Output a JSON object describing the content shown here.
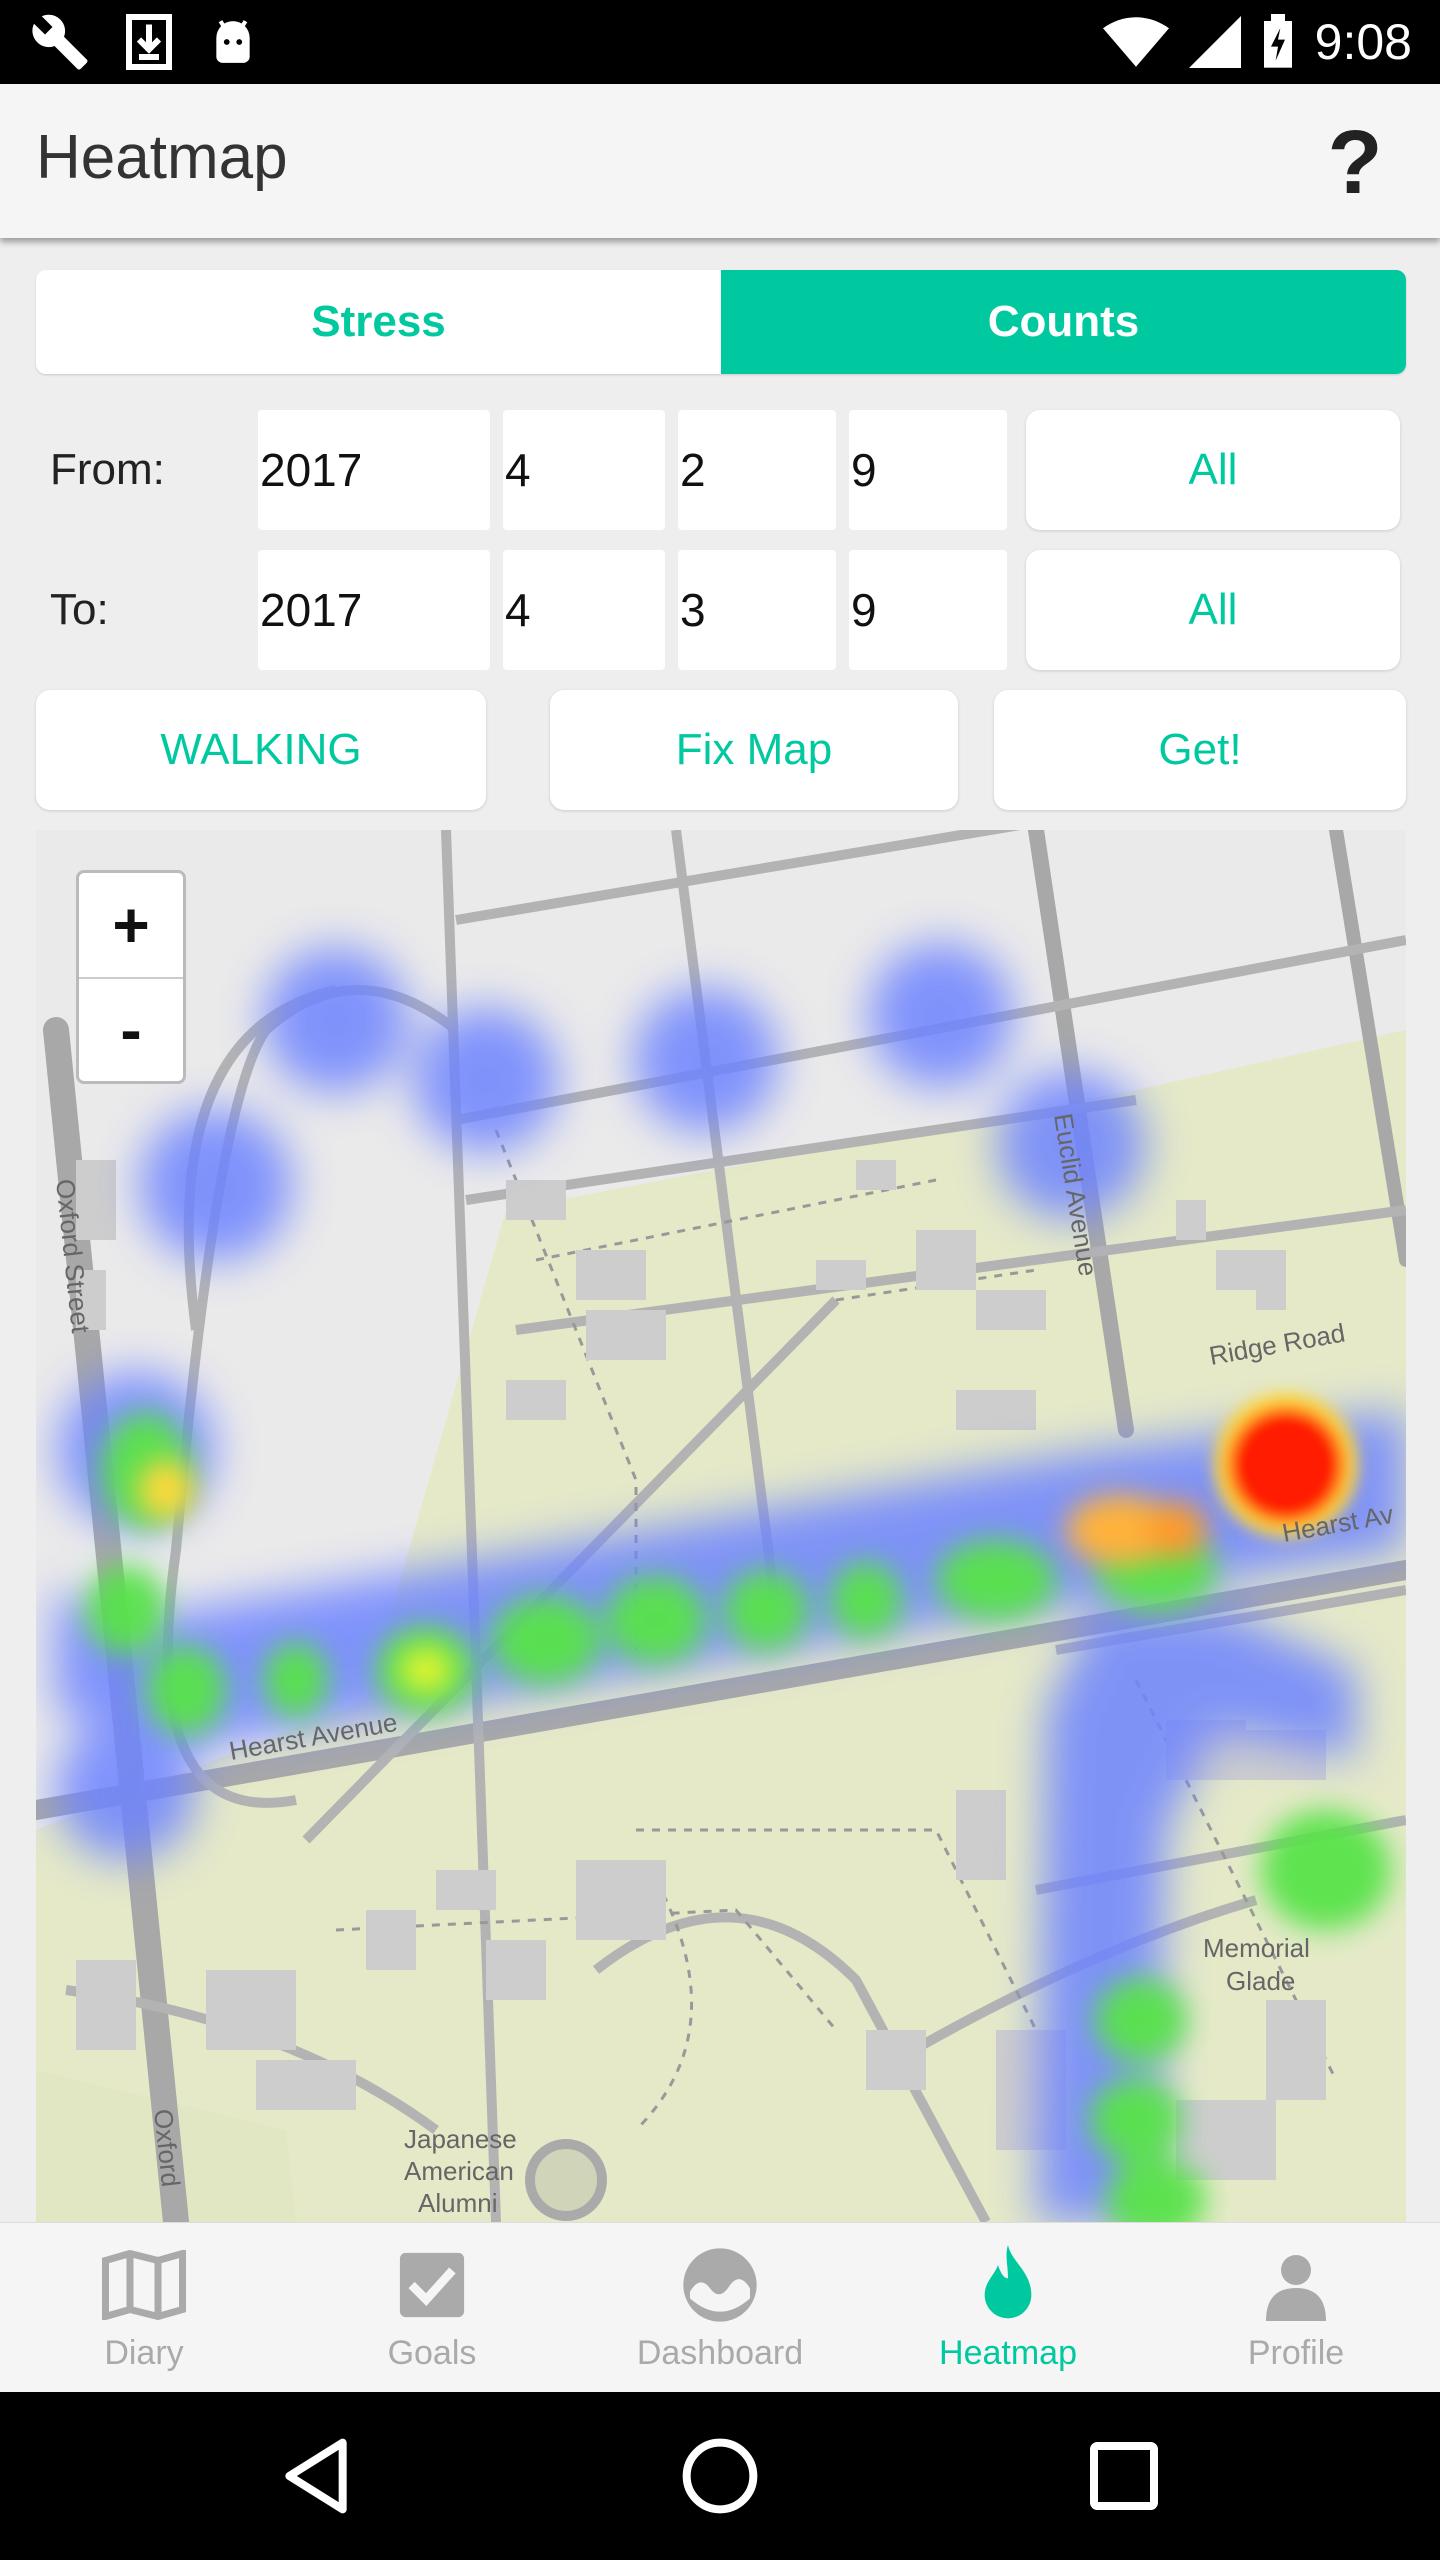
{
  "status_bar": {
    "time": "9:08"
  },
  "app_bar": {
    "title": "Heatmap",
    "help_label": "?"
  },
  "tabs": [
    {
      "label": "Stress",
      "selected": false
    },
    {
      "label": "Counts",
      "selected": true
    }
  ],
  "date_range": {
    "from": {
      "label": "From:",
      "year": "2017",
      "month": "4",
      "day": "2",
      "hour": "9",
      "all_label": "All"
    },
    "to": {
      "label": "To:",
      "year": "2017",
      "month": "4",
      "day": "3",
      "hour": "9",
      "all_label": "All"
    }
  },
  "actions": {
    "activity_label": "WALKING",
    "fix_map_label": "Fix Map",
    "get_label": "Get!"
  },
  "map": {
    "zoom_in_label": "+",
    "zoom_out_label": "-",
    "labels": {
      "oxford_street": "Oxford Street",
      "oxford": "Oxford",
      "euclid_avenue": "Euclid Avenue",
      "ridge_road": "Ridge Road",
      "hearst_avenue": "Hearst Avenue",
      "hearst_av": "Hearst Av",
      "memorial": "Memorial",
      "glade": "Glade",
      "japanese": "Japanese",
      "american": "American",
      "alumni": "Alumni"
    }
  },
  "bottom_nav": [
    {
      "label": "Diary",
      "icon": "map-icon"
    },
    {
      "label": "Goals",
      "icon": "checkbox-icon"
    },
    {
      "label": "Dashboard",
      "icon": "gauge-icon"
    },
    {
      "label": "Heatmap",
      "icon": "flame-icon",
      "active": true
    },
    {
      "label": "Profile",
      "icon": "person-icon"
    }
  ],
  "colors": {
    "accent": "#00c9a0",
    "heat_low": "#5b78ff",
    "heat_mid": "#5ae64a",
    "heat_high": "#ff0000"
  }
}
